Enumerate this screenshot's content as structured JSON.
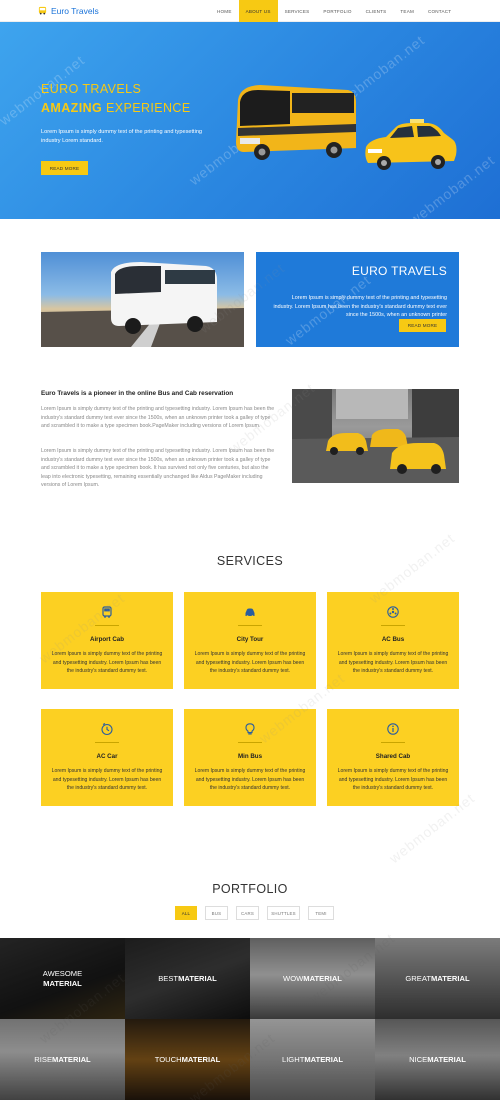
{
  "nav": {
    "brand": "Euro Travels",
    "items": [
      "HOME",
      "ABOUT US",
      "SERVICES",
      "PORTFOLIO",
      "CLIENTS",
      "TEAM",
      "CONTACT"
    ],
    "active": "ABOUT US"
  },
  "hero": {
    "line1": "EURO TRAVELS",
    "line2_bold": "AMAZING",
    "line2_rest": "EXPERIENCE",
    "text": "Lorem Ipsum is simply dummy text of the printing and typesetting industry Lorem standard.",
    "button": "READ MORE"
  },
  "about": {
    "title": "EURO TRAVELS",
    "text": "Lorem Ipsum is simply dummy text of the printing and typesetting industry. Lorem Ipsum has been the industry's standard dummy text ever since the 1500s, when an unknown printer",
    "button": "READ MORE"
  },
  "intro": {
    "heading": "Euro Travels is a pioneer in the online Bus and Cab reservation",
    "para1": "Lorem Ipsum is simply dummy text of the printing and typesetting industry. Lorem Ipsum has been the industry's standard dummy text ever since the 1500s, when an unknown printer took a galley of type and scrambled it to make a type specimen book.PageMaker including versions of Lorem Ipsum.",
    "para2": "Lorem Ipsum is simply dummy text of the printing and typesetting industry. Lorem Ipsum has been the industry's standard dummy text ever since the 1500s, when an unknown printer took a galley of type and scrambled it to make a type specimen book. It has survived not only five centuries, but also the leap into electronic typesetting, remaining essentially unchanged like Aldus PageMaker including versions of Lorem Ipsum."
  },
  "services": {
    "title": "SERVICES",
    "items": [
      {
        "name": "Airport Cab",
        "icon": "bus-icon",
        "text": "Lorem Ipsum is simply dummy text of the printing and typesetting industry. Lorem Ipsum has been the industry's standard dummy text."
      },
      {
        "name": "City Tour",
        "icon": "car-icon",
        "text": "Lorem Ipsum is simply dummy text of the printing and typesetting industry. Lorem Ipsum has been the industry's standard dummy text."
      },
      {
        "name": "AC Bus",
        "icon": "fan-icon",
        "text": "Lorem Ipsum is simply dummy text of the printing and typesetting industry. Lorem Ipsum has been the industry's standard dummy text."
      },
      {
        "name": "AC Car",
        "icon": "clock-icon",
        "text": "Lorem Ipsum is simply dummy text of the printing and typesetting industry. Lorem Ipsum has been the industry's standard dummy text."
      },
      {
        "name": "Min Bus",
        "icon": "bulb-icon",
        "text": "Lorem Ipsum is simply dummy text of the printing and typesetting industry. Lorem Ipsum has been the industry's standard dummy text."
      },
      {
        "name": "Shared Cab",
        "icon": "info-icon",
        "text": "Lorem Ipsum is simply dummy text of the printing and typesetting industry. Lorem Ipsum has been the industry's standard dummy text."
      }
    ]
  },
  "portfolio": {
    "title": "PORTFOLIO",
    "filters": [
      "ALL",
      "BUS",
      "CARS",
      "SHUTTLES",
      "TEMI"
    ],
    "active_filter": "ALL",
    "tiles": [
      {
        "light": "AWESOME",
        "bold": "MATERIAL"
      },
      {
        "light": "BEST",
        "bold": "MATERIAL"
      },
      {
        "light": "WOW",
        "bold": "MATERIAL"
      },
      {
        "light": "GREAT",
        "bold": "MATERIAL"
      },
      {
        "light": "RISE",
        "bold": "MATERIAL"
      },
      {
        "light": "TOUCH",
        "bold": "MATERIAL"
      },
      {
        "light": "LIGHT",
        "bold": "MATERIAL"
      },
      {
        "light": "NICE",
        "bold": "MATERIAL"
      }
    ]
  },
  "watermark": "webmoban.net",
  "colors": {
    "accent": "#f7c913",
    "primary": "#1f7ad9",
    "card": "#fcd022"
  }
}
